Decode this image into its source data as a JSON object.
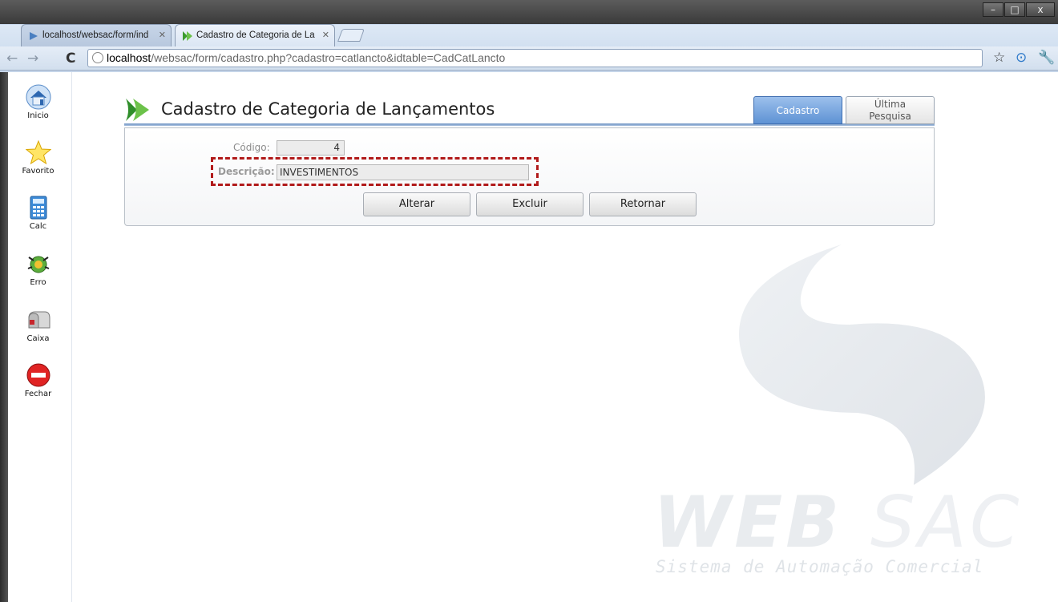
{
  "browser": {
    "tabs": [
      {
        "label": "localhost/websac/form/ind",
        "active": false
      },
      {
        "label": "Cadastro de Categoria de La",
        "active": true
      }
    ],
    "url_host": "localhost",
    "url_path": "/websac/form/cadastro.php?cadastro=catlancto&idtable=CadCatLancto",
    "window_buttons": [
      "–",
      "□",
      "x"
    ]
  },
  "dock": {
    "items": [
      {
        "label": "Inicio",
        "icon": "home-icon"
      },
      {
        "label": "Favorito",
        "icon": "star-icon"
      },
      {
        "label": "Calc",
        "icon": "calculator-icon"
      },
      {
        "label": "Erro",
        "icon": "bug-icon"
      },
      {
        "label": "Caixa",
        "icon": "mailbox-icon"
      },
      {
        "label": "Fechar",
        "icon": "close-icon"
      }
    ]
  },
  "page": {
    "title": "Cadastro de Categoria de Lançamentos",
    "tabs": {
      "cadastro": "Cadastro",
      "ultima_line1": "Última",
      "ultima_line2": "Pesquisa"
    }
  },
  "form": {
    "codigo_label": "Código:",
    "codigo_value": "4",
    "descricao_label": "Descrição:",
    "descricao_value": "INVESTIMENTOS"
  },
  "buttons": {
    "alterar": "Alterar",
    "excluir": "Excluir",
    "retornar": "Retornar"
  },
  "watermark": {
    "brand_part1": "WEB",
    "brand_part2": "SAC",
    "tagline": "Sistema de Automação Comercial"
  },
  "colors": {
    "accent": "#5e92d4",
    "highlight": "#b11a1a",
    "dock_edge": "#2b2b2b"
  }
}
